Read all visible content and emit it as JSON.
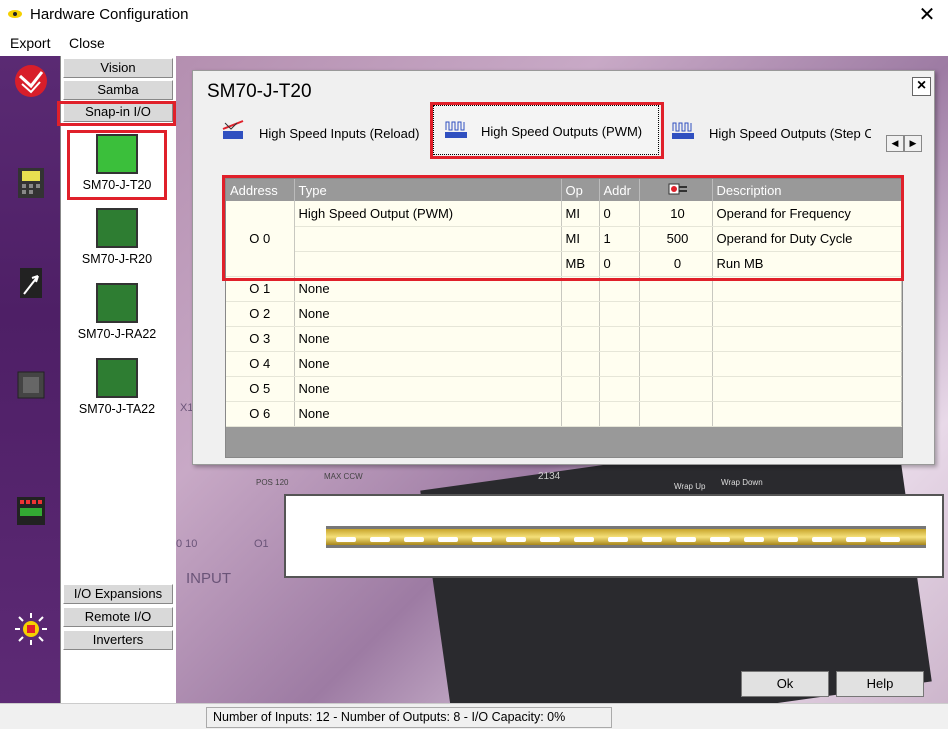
{
  "window": {
    "title": "Hardware Configuration",
    "close_glyph": "✕"
  },
  "menu": {
    "export": "Export",
    "close": "Close"
  },
  "categories_top": [
    "Vision",
    "Samba",
    "Snap-in I/O"
  ],
  "modules": [
    "SM70-J-T20",
    "SM70-J-R20",
    "SM70-J-RA22",
    "SM70-J-TA22"
  ],
  "categories_bottom": [
    "I/O Expansions",
    "Remote I/O",
    "Inverters"
  ],
  "dialog": {
    "title": "SM70-J-T20",
    "close_glyph": "×",
    "tabs": [
      "High Speed Inputs (Reload)",
      "High Speed Outputs (PWM)",
      "High Speed Outputs (Step C"
    ],
    "scroll_left": "◀",
    "scroll_right": "▶"
  },
  "grid": {
    "headers": [
      "Address",
      "Type",
      "Op",
      "Addr",
      "",
      "Description"
    ],
    "group_address": "O 0",
    "group_type": "High Speed Output (PWM)",
    "group_rows": [
      {
        "op": "MI",
        "addr": "0",
        "val": "10",
        "desc": "Operand for Frequency"
      },
      {
        "op": "MI",
        "addr": "1",
        "val": "500",
        "desc": "Operand for Duty Cycle"
      },
      {
        "op": "MB",
        "addr": "0",
        "val": "0",
        "desc": "Run MB"
      }
    ],
    "other_rows": [
      {
        "address": "O 1",
        "type": "None"
      },
      {
        "address": "O 2",
        "type": "None"
      },
      {
        "address": "O 3",
        "type": "None"
      },
      {
        "address": "O 4",
        "type": "None"
      },
      {
        "address": "O 5",
        "type": "None"
      },
      {
        "address": "O 6",
        "type": "None"
      }
    ]
  },
  "background": {
    "t1": "X1",
    "t2": "0 10",
    "t3": "O1",
    "t4": "INPUT",
    "t5": "MAX CCW",
    "t6": "POS 120",
    "t7": "2134",
    "t8": "Wrap Up",
    "t9": "Wrap Down"
  },
  "buttons": {
    "ok": "Ok",
    "help": "Help"
  },
  "status": "Number of Inputs: 12  -  Number of Outputs: 8  -  I/O Capacity: 0%",
  "colors": {
    "highlight": "#e0202a",
    "sidebar": "#5a2a73"
  }
}
